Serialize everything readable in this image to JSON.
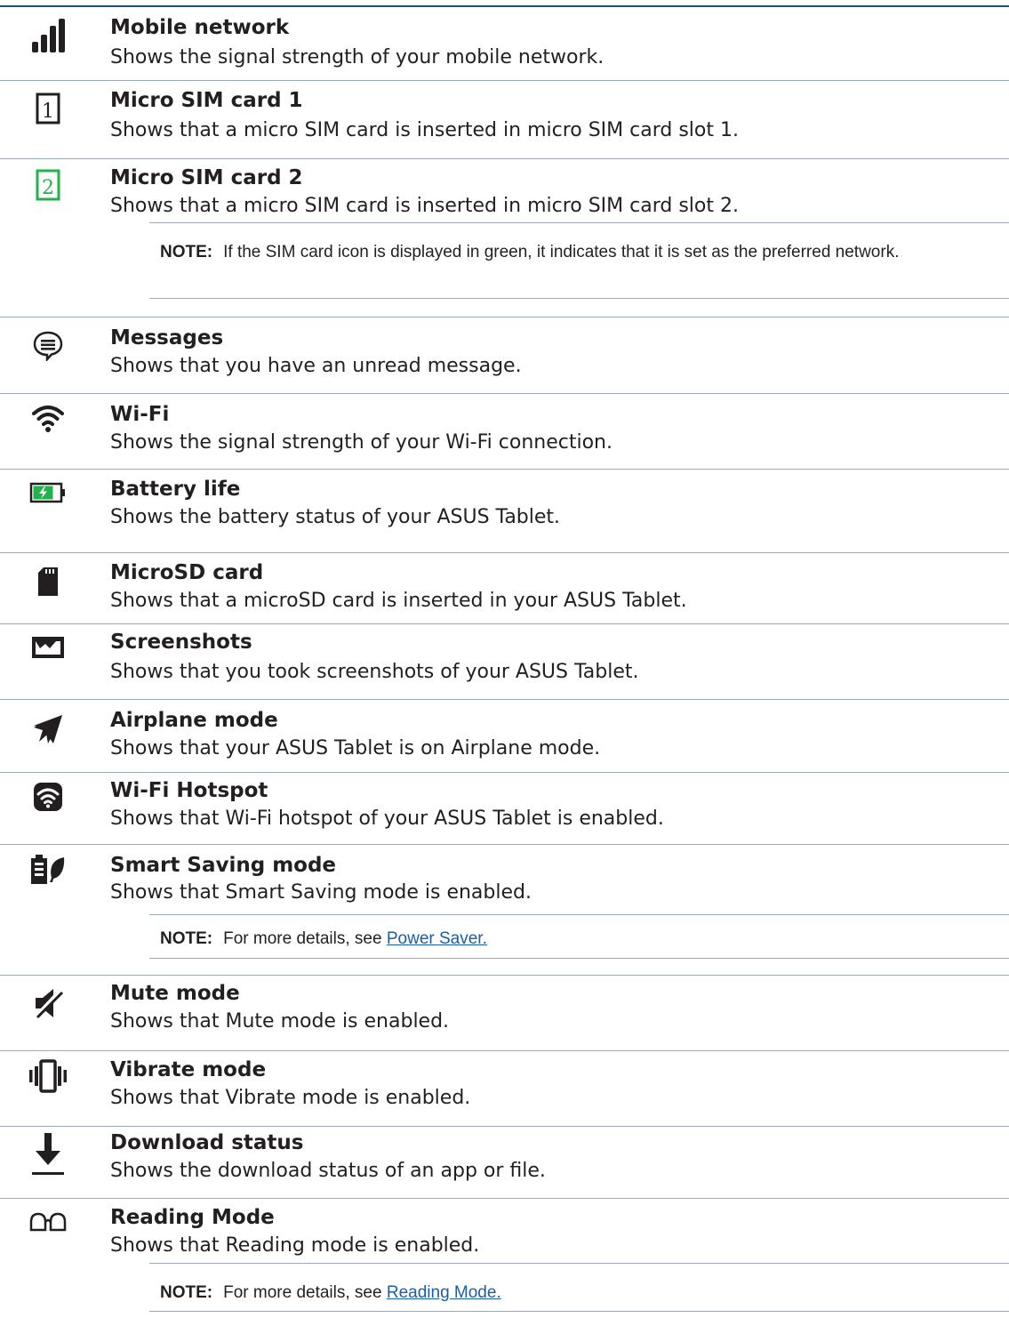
{
  "items": [
    {
      "icon": "signal-bars-icon",
      "title": "Mobile network",
      "desc": "Shows the signal strength of your mobile network."
    },
    {
      "icon": "sim-card-1-icon",
      "title": "Micro SIM card 1",
      "desc": "Shows that a micro SIM card is inserted in micro SIM card slot 1."
    },
    {
      "icon": "sim-card-2-icon",
      "title": "Micro SIM card 2",
      "desc": "Shows that a micro SIM card is inserted in micro SIM card slot 2."
    },
    {
      "icon": "message-icon",
      "title": "Messages",
      "desc": "Shows that you have an unread message."
    },
    {
      "icon": "wifi-icon",
      "title": "Wi-Fi",
      "desc": "Shows the signal strength of your Wi-Fi connection."
    },
    {
      "icon": "battery-icon",
      "title": "Battery life",
      "desc": "Shows the battery status of your ASUS Tablet."
    },
    {
      "icon": "microsd-icon",
      "title": "MicroSD card",
      "desc": "Shows that a microSD card is inserted in your ASUS Tablet."
    },
    {
      "icon": "screenshot-icon",
      "title": "Screenshots",
      "desc": "Shows that you took screenshots of your ASUS Tablet."
    },
    {
      "icon": "airplane-icon",
      "title": "Airplane mode",
      "desc": "Shows that your ASUS Tablet is on Airplane mode."
    },
    {
      "icon": "hotspot-icon",
      "title": "Wi-Fi Hotspot",
      "desc": "Shows that Wi-Fi hotspot of your ASUS Tablet is enabled."
    },
    {
      "icon": "smart-saving-icon",
      "title": "Smart Saving mode",
      "desc": "Shows that Smart Saving mode is enabled."
    },
    {
      "icon": "mute-icon",
      "title": "Mute mode",
      "desc": "Shows that Mute mode is enabled."
    },
    {
      "icon": "vibrate-icon",
      "title": "Vibrate mode",
      "desc": "Shows that Vibrate mode is enabled."
    },
    {
      "icon": "download-icon",
      "title": "Download status",
      "desc": "Shows the download status of an app or file."
    },
    {
      "icon": "reading-glasses-icon",
      "title": "Reading Mode",
      "desc": "Shows that Reading mode is enabled."
    }
  ],
  "notes": {
    "sim": {
      "label": "NOTE:",
      "text": "If the SIM card icon is displayed in green, it indicates that it is set as the preferred network."
    },
    "power": {
      "label": "NOTE:",
      "text": "For more details, see ",
      "link": "Power Saver."
    },
    "reading": {
      "label": "NOTE:",
      "text": "For more details, see ",
      "link": "Reading Mode."
    }
  },
  "colors": {
    "accent_green": "#22b24c",
    "link": "#1a5ea8",
    "rule": "#9aa9bd",
    "top_rule": "#1f4e79"
  }
}
